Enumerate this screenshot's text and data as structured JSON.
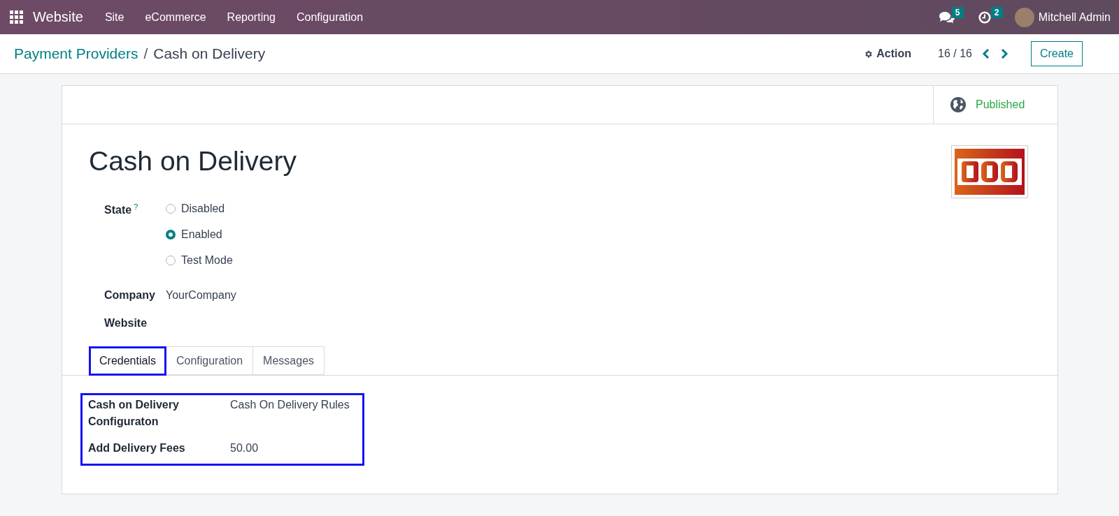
{
  "navbar": {
    "app": "Website",
    "menu": [
      "Site",
      "eCommerce",
      "Reporting",
      "Configuration"
    ],
    "messages_count": "5",
    "activities_count": "2",
    "user": "Mitchell Admin"
  },
  "control_panel": {
    "breadcrumb": [
      "Payment Providers",
      "Cash on Delivery"
    ],
    "breadcrumb_separator": "/",
    "action": "Action",
    "pager": "16 / 16",
    "create": "Create"
  },
  "form": {
    "published": "Published",
    "title": "Cash on Delivery",
    "state": {
      "label": "State",
      "help": "?",
      "options": [
        {
          "label": "Disabled",
          "selected": false
        },
        {
          "label": "Enabled",
          "selected": true
        },
        {
          "label": "Test Mode",
          "selected": false
        }
      ]
    },
    "fields": [
      {
        "label": "Company",
        "value": "YourCompany"
      },
      {
        "label": "Website"
      }
    ],
    "tabs": [
      {
        "label": "Credentials",
        "selected": true,
        "highlighted": true
      },
      {
        "label": "Configuration",
        "selected": false,
        "highlighted": false
      },
      {
        "label": "Messages",
        "selected": false,
        "highlighted": false
      }
    ],
    "credentials": {
      "highlighted": true,
      "fields": [
        {
          "label": "Cash on Delivery Configuraton",
          "value": "Cash On Delivery Rules"
        },
        {
          "label": "Add Delivery Fees",
          "value": "50.00"
        }
      ]
    }
  }
}
